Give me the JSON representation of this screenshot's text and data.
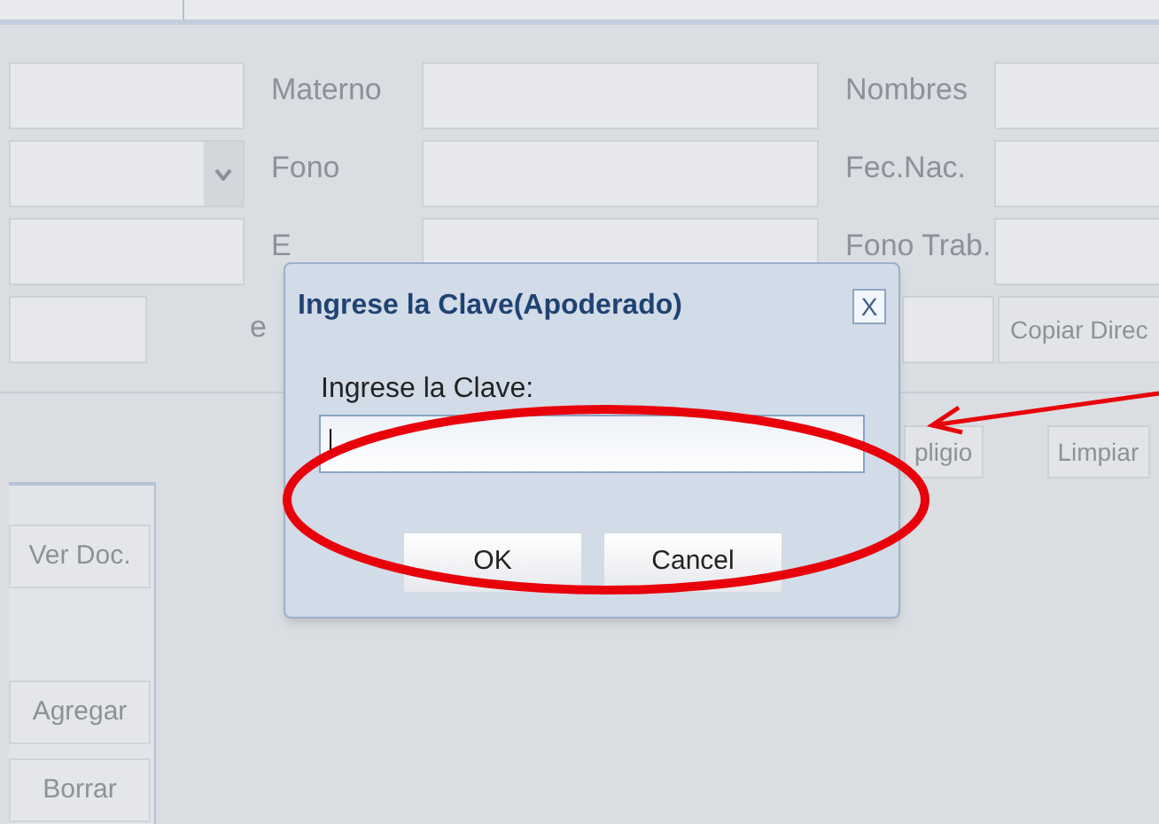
{
  "form": {
    "rows": [
      [
        {
          "kind": "field"
        },
        {
          "kind": "label",
          "text": "Materno"
        },
        {
          "kind": "field"
        },
        {
          "kind": "label",
          "text": "Nombres"
        },
        {
          "kind": "field"
        }
      ],
      [
        {
          "kind": "combo"
        },
        {
          "kind": "label",
          "text": "Fono"
        },
        {
          "kind": "field"
        },
        {
          "kind": "label",
          "text": "Fec.Nac."
        },
        {
          "kind": "field"
        }
      ],
      [
        {
          "kind": "field"
        },
        {
          "kind": "label",
          "text": "E"
        },
        {
          "kind": "field"
        },
        {
          "kind": "label",
          "text": "Fono Trab."
        },
        {
          "kind": "field"
        }
      ],
      [
        {
          "kind": "field-short"
        },
        {
          "kind": "label-tight",
          "text": "e"
        },
        {
          "kind": "field-right"
        },
        {
          "kind": "button",
          "text": "Copiar Direc"
        }
      ]
    ]
  },
  "actions": [
    {
      "text": "pligio"
    },
    {
      "text": "Limpiar"
    }
  ],
  "side_panel": {
    "buttons": [
      {
        "text": "Ver Doc."
      },
      {
        "text": "Agregar"
      },
      {
        "text": "Borrar"
      }
    ]
  },
  "dialog": {
    "title": "Ingrese la Clave(Apoderado)",
    "close": "X",
    "field_label": "Ingrese la Clave:",
    "buttons": [
      "OK",
      "Cancel"
    ]
  }
}
